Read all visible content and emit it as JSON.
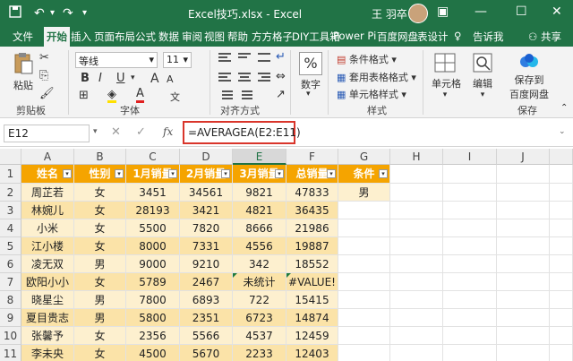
{
  "title": "Excel技巧.xlsx  -  Excel",
  "user": "王 羽卒",
  "tabs": [
    "文件",
    "开始",
    "插入",
    "页面布局",
    "公式",
    "数据",
    "审阅",
    "视图",
    "帮助",
    "方方格子",
    "DIY工具箱",
    "Power Pi",
    "百度网盘",
    "表设计",
    "告诉我",
    "共享"
  ],
  "ribbon": {
    "paste": "粘贴",
    "clipboard": "剪贴板",
    "font_name": "等线",
    "font_size": "11",
    "font_group": "字体",
    "align_group": "对齐方式",
    "number_symbol": "%",
    "number": "数字",
    "cond_format": "条件格式",
    "table_format": "套用表格格式",
    "cell_style": "单元格样式",
    "style_group": "样式",
    "cells": "单元格",
    "edit": "编辑",
    "save_to_line1": "保存到",
    "save_to_line2": "百度网盘",
    "save_group": "保存",
    "bold": "B",
    "italic": "I",
    "underline": "U",
    "font_color_letter": "A",
    "grow_a": "A",
    "shrink_a": "A"
  },
  "formula_bar": {
    "name_box": "E12",
    "fx": "fx",
    "formula": "=AVERAGEA(E2:E11)"
  },
  "columns": [
    "A",
    "B",
    "C",
    "D",
    "E",
    "F",
    "G",
    "H",
    "I",
    "J"
  ],
  "rows": [
    "1",
    "2",
    "3",
    "4",
    "5",
    "6",
    "7",
    "8",
    "9",
    "10",
    "11"
  ],
  "header_row": [
    "姓名",
    "性别",
    "1月销量",
    "2月销量",
    "3月销量",
    "总销量",
    "条件"
  ],
  "data_rows": [
    [
      "周芷若",
      "女",
      "3451",
      "34561",
      "9821",
      "47833",
      "男"
    ],
    [
      "林婉儿",
      "女",
      "28193",
      "3421",
      "4821",
      "36435",
      ""
    ],
    [
      "小米",
      "女",
      "5500",
      "7820",
      "8666",
      "21986",
      ""
    ],
    [
      "江小楼",
      "女",
      "8000",
      "7331",
      "4556",
      "19887",
      ""
    ],
    [
      "凌无双",
      "男",
      "9000",
      "9210",
      "342",
      "18552",
      ""
    ],
    [
      "欧阳小小",
      "女",
      "5789",
      "2467",
      "未统计",
      "#VALUE!",
      ""
    ],
    [
      "晓星尘",
      "男",
      "7800",
      "6893",
      "722",
      "15415",
      ""
    ],
    [
      "夏目贵志",
      "男",
      "5800",
      "2351",
      "6723",
      "14874",
      ""
    ],
    [
      "张馨予",
      "女",
      "2356",
      "5566",
      "4537",
      "12459",
      ""
    ],
    [
      "李未央",
      "女",
      "4500",
      "5670",
      "2233",
      "12403",
      ""
    ]
  ],
  "colors": {
    "accent": "#217346",
    "header_fill": "#f5a400",
    "band_odd": "#fdf0cf",
    "band_even": "#fbe3a8",
    "highlight": "#d9352b"
  }
}
